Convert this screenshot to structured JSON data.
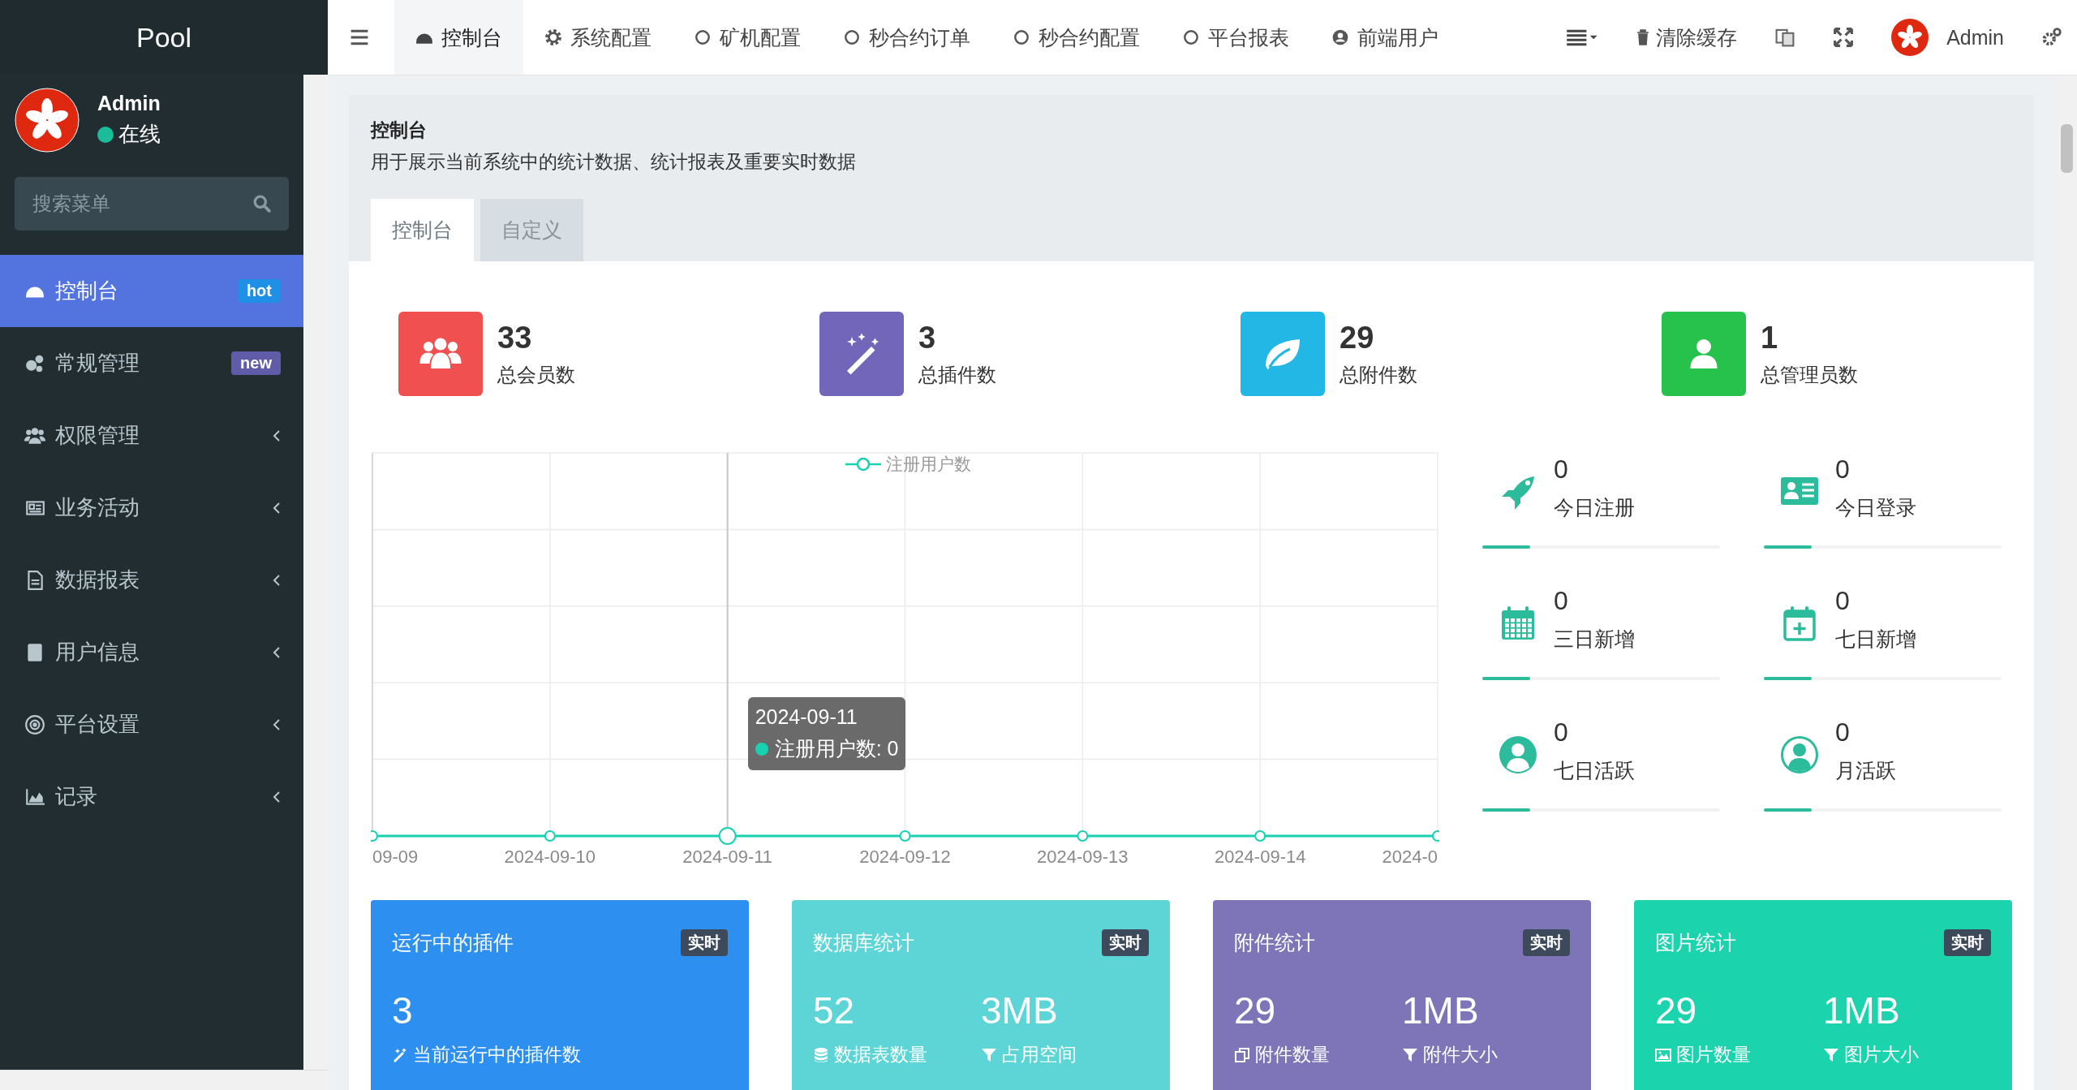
{
  "brand": "Pool",
  "user": {
    "name": "Admin",
    "status": "在线",
    "online": true
  },
  "search": {
    "placeholder": "搜索菜单"
  },
  "menu": [
    {
      "label": "控制台",
      "selected": true,
      "kind": "badge",
      "badge": "hot",
      "color": "#1e91e6"
    },
    {
      "label": "常规管理",
      "selected": false,
      "kind": "badge",
      "badge": "new",
      "color": "#605ca8"
    },
    {
      "label": "权限管理",
      "selected": false,
      "kind": "tree"
    },
    {
      "label": "业务活动",
      "selected": false,
      "kind": "tree"
    },
    {
      "label": "数据报表",
      "selected": false,
      "kind": "tree"
    },
    {
      "label": "用户信息",
      "selected": false,
      "kind": "tree"
    },
    {
      "label": "平台设置",
      "selected": false,
      "kind": "tree"
    },
    {
      "label": "记录",
      "selected": false,
      "kind": "tree"
    }
  ],
  "nav_tabs": [
    {
      "label": "控制台",
      "selected": true
    },
    {
      "label": "系统配置",
      "selected": false
    },
    {
      "label": "矿机配置",
      "selected": false
    },
    {
      "label": "秒合约订单",
      "selected": false
    },
    {
      "label": "秒合约配置",
      "selected": false
    },
    {
      "label": "平台报表",
      "selected": false
    },
    {
      "label": "前端用户",
      "selected": false
    }
  ],
  "toolbar": {
    "clear_cache": "清除缓存",
    "user": "Admin"
  },
  "page": {
    "title": "控制台",
    "description": "用于展示当前系统中的统计数据、统计报表及重要实时数据",
    "tabs": [
      {
        "label": "控制台",
        "selected": true
      },
      {
        "label": "自定义",
        "selected": false
      }
    ]
  },
  "stats": [
    {
      "value": "33",
      "label": "总会员数",
      "color": "#f05050"
    },
    {
      "value": "3",
      "label": "总插件数",
      "color": "#7266ba"
    },
    {
      "value": "29",
      "label": "总附件数",
      "color": "#23b7e5"
    },
    {
      "value": "1",
      "label": "总管理员数",
      "color": "#27c24c"
    }
  ],
  "chart": {
    "legend": "注册用户数",
    "x_labels": [
      "09-09",
      "2024-09-10",
      "2024-09-11",
      "2024-09-12",
      "2024-09-13",
      "2024-09-14",
      "2024-0"
    ]
  },
  "chart_tooltip": {
    "title": "2024-09-11",
    "text": "注册用户数: 0"
  },
  "quick_stats": [
    {
      "value": "0",
      "label": "今日注册",
      "level": 0.2
    },
    {
      "value": "0",
      "label": "今日登录",
      "level": 0.2
    },
    {
      "value": "0",
      "label": "三日新增",
      "level": 0.2
    },
    {
      "value": "0",
      "label": "七日新增",
      "level": 0.2
    },
    {
      "value": "0",
      "label": "七日活跃",
      "level": 0.2
    },
    {
      "value": "0",
      "label": "月活跃",
      "level": 0.2
    }
  ],
  "cards": [
    {
      "title": "运行中的插件",
      "badge": "实时",
      "color": "#2d8ff0",
      "metrics": [
        {
          "value": "3",
          "label": "当前运行中的插件数"
        }
      ]
    },
    {
      "title": "数据库统计",
      "badge": "实时",
      "color": "#5dd5d6",
      "metrics": [
        {
          "value": "52",
          "label": "数据表数量"
        },
        {
          "value": "3MB",
          "label": "占用空间"
        }
      ]
    },
    {
      "title": "附件统计",
      "badge": "实时",
      "color": "#7d75b8",
      "metrics": [
        {
          "value": "29",
          "label": "附件数量"
        },
        {
          "value": "1MB",
          "label": "附件大小"
        }
      ]
    },
    {
      "title": "图片统计",
      "badge": "实时",
      "color": "#1bd3ad",
      "metrics": [
        {
          "value": "29",
          "label": "图片数量"
        },
        {
          "value": "1MB",
          "label": "图片大小"
        }
      ]
    }
  ]
}
